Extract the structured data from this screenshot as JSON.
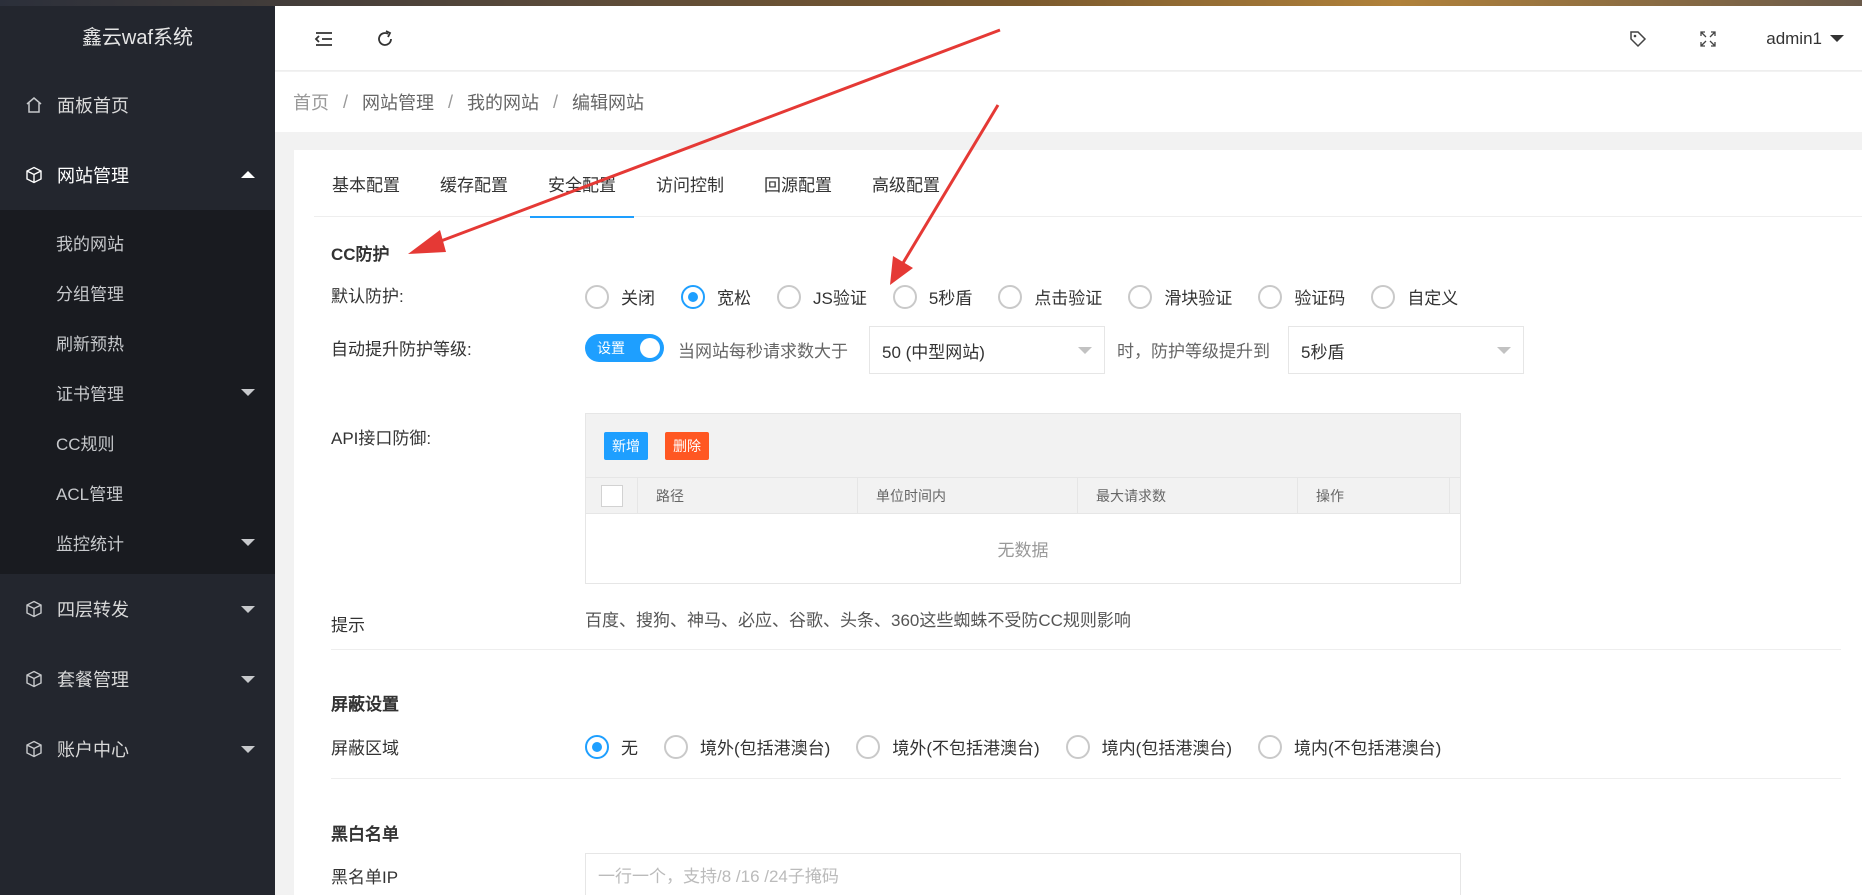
{
  "app": {
    "title": "鑫云waf系统"
  },
  "sidebar": {
    "items": [
      {
        "label": "面板首页",
        "icon": "home-icon"
      },
      {
        "label": "网站管理",
        "icon": "cube-icon"
      },
      {
        "label": "四层转发",
        "icon": "cube-icon"
      },
      {
        "label": "套餐管理",
        "icon": "cube-icon"
      },
      {
        "label": "账户中心",
        "icon": "cube-icon"
      }
    ],
    "sub_items": [
      {
        "label": "我的网站"
      },
      {
        "label": "分组管理"
      },
      {
        "label": "刷新预热"
      },
      {
        "label": "证书管理"
      },
      {
        "label": "CC规则"
      },
      {
        "label": "ACL管理"
      },
      {
        "label": "监控统计"
      }
    ]
  },
  "header": {
    "user": "admin1",
    "icons": [
      "menu-fold-icon",
      "refresh-icon",
      "tag-icon",
      "fullscreen-icon"
    ]
  },
  "breadcrumb": [
    "首页",
    "网站管理",
    "我的网站",
    "编辑网站"
  ],
  "tabs": [
    "基本配置",
    "缓存配置",
    "安全配置",
    "访问控制",
    "回源配置",
    "高级配置"
  ],
  "cc": {
    "title": "CC防护",
    "default_label": "默认防护:",
    "options": [
      "关闭",
      "宽松",
      "JS验证",
      "5秒盾",
      "点击验证",
      "滑块验证",
      "验证码",
      "自定义"
    ],
    "selected": "宽松",
    "auto_label": "自动提升防护等级:",
    "switch_text": "设置",
    "text_before": "当网站每秒请求数大于",
    "threshold": "50 (中型网站)",
    "text_after": "时，防护等级提升到",
    "upgrade_level": "5秒盾",
    "api_label": "API接口防御:",
    "add_button": "新增",
    "delete_button": "删除",
    "columns": [
      "路径",
      "单位时间内",
      "最大请求数",
      "操作"
    ],
    "empty_text": "无数据",
    "tip_label": "提示",
    "tip_text": "百度、搜狗、神马、必应、谷歌、头条、360这些蜘蛛不受防CC规则影响"
  },
  "block": {
    "title": "屏蔽设置",
    "area_label": "屏蔽区域",
    "options": [
      "无",
      "境外(包括港澳台)",
      "境外(不包括港澳台)",
      "境内(包括港澳台)",
      "境内(不包括港澳台)"
    ],
    "selected": "无"
  },
  "blackwhite": {
    "title": "黑白名单",
    "blacklist_label": "黑名单IP",
    "blacklist_placeholder": "一行一个，支持/8 /16 /24子掩码"
  },
  "colors": {
    "accent": "#1e9fff",
    "danger": "#ff5722",
    "sidebar": "#23262e",
    "annotation": "#e53935"
  }
}
